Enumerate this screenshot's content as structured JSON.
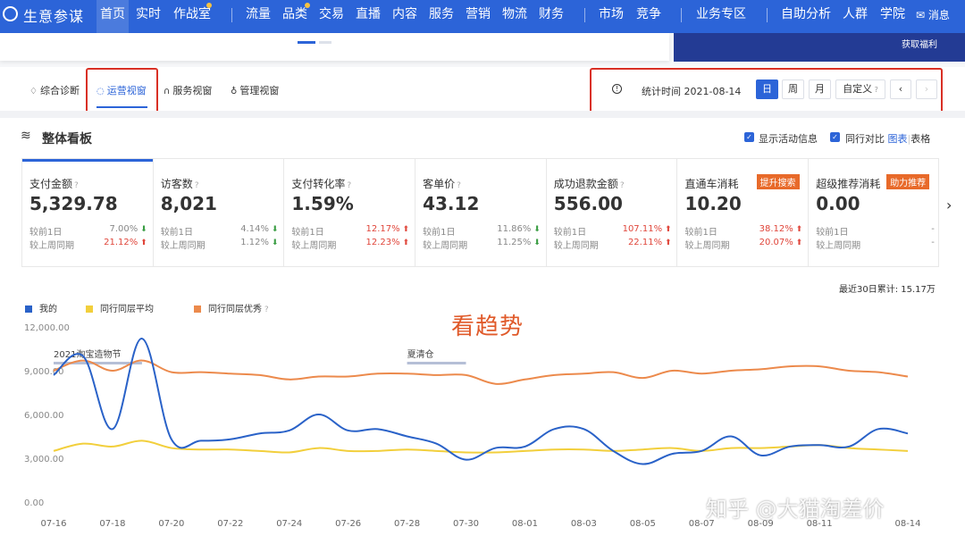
{
  "topnav": {
    "brand": "生意参谋",
    "items": [
      {
        "label": "首页"
      },
      {
        "label": "实时"
      },
      {
        "label": "作战室"
      },
      {
        "label": "流量"
      },
      {
        "label": "品类"
      },
      {
        "label": "交易"
      },
      {
        "label": "直播"
      },
      {
        "label": "内容"
      },
      {
        "label": "服务"
      },
      {
        "label": "营销"
      },
      {
        "label": "物流"
      },
      {
        "label": "财务"
      },
      {
        "label": "市场"
      },
      {
        "label": "竞争"
      },
      {
        "label": "业务专区"
      },
      {
        "label": "自助分析"
      },
      {
        "label": "人群"
      },
      {
        "label": "学院"
      }
    ],
    "message": "消息"
  },
  "promo": {
    "text": "获取福利"
  },
  "tabs": [
    {
      "label": "综合诊断"
    },
    {
      "label": "运营视窗"
    },
    {
      "label": "服务视窗"
    },
    {
      "label": "管理视窗"
    }
  ],
  "time": {
    "label": "统计时间 2021-08-14",
    "buttons": [
      "日",
      "周",
      "月",
      "自定义"
    ]
  },
  "section": {
    "title": "整体看板",
    "show_activity": "显示活动信息",
    "peer_compare": "同行对比",
    "view_chart": "图表",
    "view_sep": "|",
    "view_table": "表格"
  },
  "cards": [
    {
      "title": "支付金额",
      "value": "5,329.78",
      "row1": "较前1日",
      "pct1": "7.00%",
      "dir1": "down",
      "row2": "较上周同期",
      "pct2": "21.12%",
      "dir2": "up"
    },
    {
      "title": "访客数",
      "value": "8,021",
      "row1": "较前1日",
      "pct1": "4.14%",
      "dir1": "down",
      "row2": "较上周同期",
      "pct2": "1.12%",
      "dir2": "down"
    },
    {
      "title": "支付转化率",
      "value": "1.59%",
      "row1": "较前1日",
      "pct1": "12.17%",
      "dir1": "up",
      "row2": "较上周同期",
      "pct2": "12.23%",
      "dir2": "up"
    },
    {
      "title": "客单价",
      "value": "43.12",
      "row1": "较前1日",
      "pct1": "11.86%",
      "dir1": "down",
      "row2": "较上周同期",
      "pct2": "11.25%",
      "dir2": "down"
    },
    {
      "title": "成功退款金额",
      "value": "556.00",
      "row1": "较前1日",
      "pct1": "107.11%",
      "dir1": "up",
      "row2": "较上周同期",
      "pct2": "22.11%",
      "dir2": "up"
    },
    {
      "title": "直通车消耗",
      "badge": "提升搜索",
      "value": "10.20",
      "row1": "较前1日",
      "pct1": "38.12%",
      "dir1": "up",
      "row2": "较上周同期",
      "pct2": "20.07%",
      "dir2": "up"
    },
    {
      "title": "超级推荐消耗",
      "badge": "助力推荐",
      "value": "0.00",
      "row1": "较前1日",
      "pct1": "-",
      "dir1": "none",
      "row2": "较上周同期",
      "pct2": "-",
      "dir2": "none"
    }
  ],
  "total_label": "最近30日累计: 15.17万",
  "annotation": "看趋势",
  "watermark": "知乎 @大猫淘差价",
  "colors": {
    "mine": "#2a62c8",
    "avg": "#f2cf3c",
    "top": "#ec8a4c",
    "accent": "#2c64d8"
  },
  "chart_data": {
    "type": "line",
    "x": [
      "07-16",
      "07-17",
      "07-18",
      "07-19",
      "07-20",
      "07-21",
      "07-22",
      "07-23",
      "07-24",
      "07-25",
      "07-26",
      "07-27",
      "07-28",
      "07-29",
      "07-30",
      "07-31",
      "08-01",
      "08-02",
      "08-03",
      "08-04",
      "08-05",
      "08-06",
      "08-07",
      "08-08",
      "08-09",
      "08-10",
      "08-11",
      "08-12",
      "08-13",
      "08-14"
    ],
    "x_ticks": [
      "07-16",
      "07-18",
      "07-20",
      "07-22",
      "07-24",
      "07-26",
      "07-28",
      "07-30",
      "08-01",
      "08-03",
      "08-05",
      "08-07",
      "08-09",
      "08-11",
      "08-14"
    ],
    "y_ticks": [
      "12,000.00",
      "9,000.00",
      "6,000.00",
      "3,000.00",
      "0.00"
    ],
    "ylim": [
      0,
      12000
    ],
    "series": [
      {
        "name": "我的",
        "color": "#2a62c8",
        "values": [
          8700,
          10000,
          5000,
          11200,
          4300,
          4200,
          4300,
          4700,
          4900,
          6000,
          4900,
          5000,
          4500,
          4000,
          2900,
          3700,
          3800,
          5000,
          5000,
          3500,
          2600,
          3300,
          3500,
          4500,
          3200,
          3800,
          3900,
          3800,
          5000,
          4700
        ]
      },
      {
        "name": "同行同层平均",
        "color": "#f2cf3c",
        "values": [
          3500,
          4000,
          3800,
          4200,
          3700,
          3600,
          3600,
          3500,
          3400,
          3700,
          3500,
          3500,
          3600,
          3500,
          3400,
          3400,
          3500,
          3600,
          3600,
          3500,
          3600,
          3700,
          3500,
          3700,
          3700,
          3800,
          3900,
          3700,
          3600,
          3500
        ]
      },
      {
        "name": "同行同层优秀",
        "color": "#ec8a4c",
        "values": [
          9000,
          9700,
          9000,
          9700,
          8900,
          8900,
          8800,
          8700,
          8400,
          8600,
          8600,
          8800,
          8800,
          8700,
          8700,
          8100,
          8400,
          8700,
          8800,
          8900,
          8500,
          9000,
          8800,
          9000,
          9100,
          9300,
          9300,
          9000,
          8900,
          8600
        ]
      }
    ],
    "events": [
      {
        "label": "2021淘宝造物节",
        "start": "07-16",
        "end": "07-19"
      },
      {
        "label": "夏清仓",
        "start": "07-28",
        "end": "07-30"
      }
    ],
    "grid": false,
    "legend_position": "top-left"
  }
}
